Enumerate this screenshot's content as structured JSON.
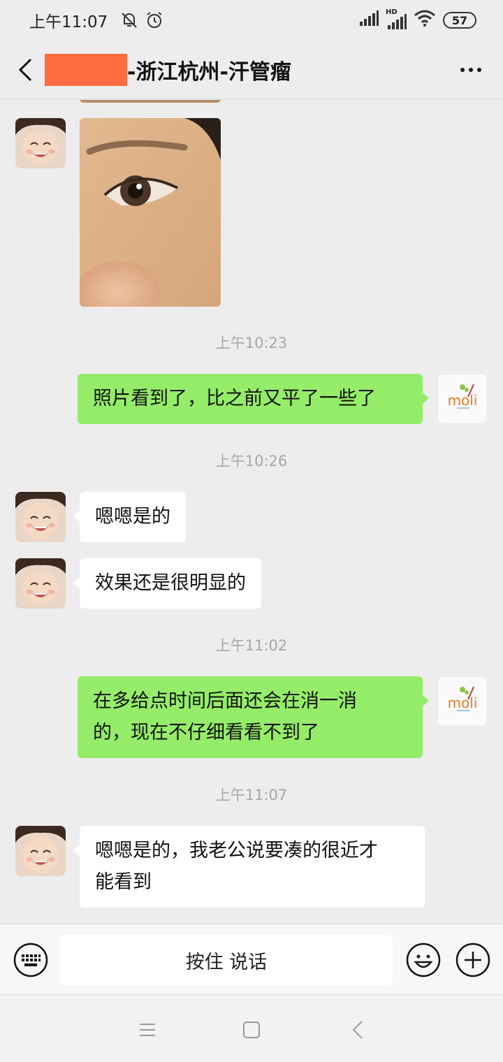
{
  "status_bar": {
    "time": "上午11:07",
    "battery": "57",
    "network_label": "HD",
    "icons": [
      "mute-icon",
      "alarm-icon",
      "signal-icon",
      "hd-signal-icon",
      "wifi-icon",
      "battery-icon"
    ]
  },
  "header": {
    "title": "-浙江杭州-汗管瘤",
    "back_icon": "chevron-left-icon",
    "more_icon": "more-dots-icon",
    "redaction_color": "#fe6c3f"
  },
  "messages": [
    {
      "type": "image",
      "side": "left",
      "description_icon": "photo"
    },
    {
      "type": "timestamp",
      "text": "上午10:23"
    },
    {
      "type": "text",
      "side": "right",
      "text": "照片看到了，比之前又平了一些了"
    },
    {
      "type": "timestamp",
      "text": "上午10:26"
    },
    {
      "type": "text",
      "side": "left",
      "text": "嗯嗯是的"
    },
    {
      "type": "text",
      "side": "left",
      "text": "效果还是很明显的"
    },
    {
      "type": "timestamp",
      "text": "上午11:02"
    },
    {
      "type": "text",
      "side": "right",
      "lines": [
        "在多给点时间后面还会在消一消",
        "的，现在不仔细看看不到了"
      ]
    },
    {
      "type": "timestamp",
      "text": "上午11:07"
    },
    {
      "type": "text",
      "side": "left",
      "lines": [
        "嗯嗯是的，我老公说要凑的很近才",
        "能看到"
      ]
    }
  ],
  "right_avatar_text": "moli",
  "input_bar": {
    "talk_label": "按住 说话",
    "keyboard_icon": "keyboard-icon",
    "emoji_icon": "emoji-icon",
    "plus_icon": "plus-icon"
  },
  "nav_bar": {
    "icons": [
      "menu-icon",
      "home-square-icon",
      "back-triangle-icon"
    ]
  },
  "colors": {
    "background": "#ededed",
    "bubble_right": "#95ec69",
    "bubble_left": "#ffffff",
    "timestamp": "#a7a7a7"
  }
}
